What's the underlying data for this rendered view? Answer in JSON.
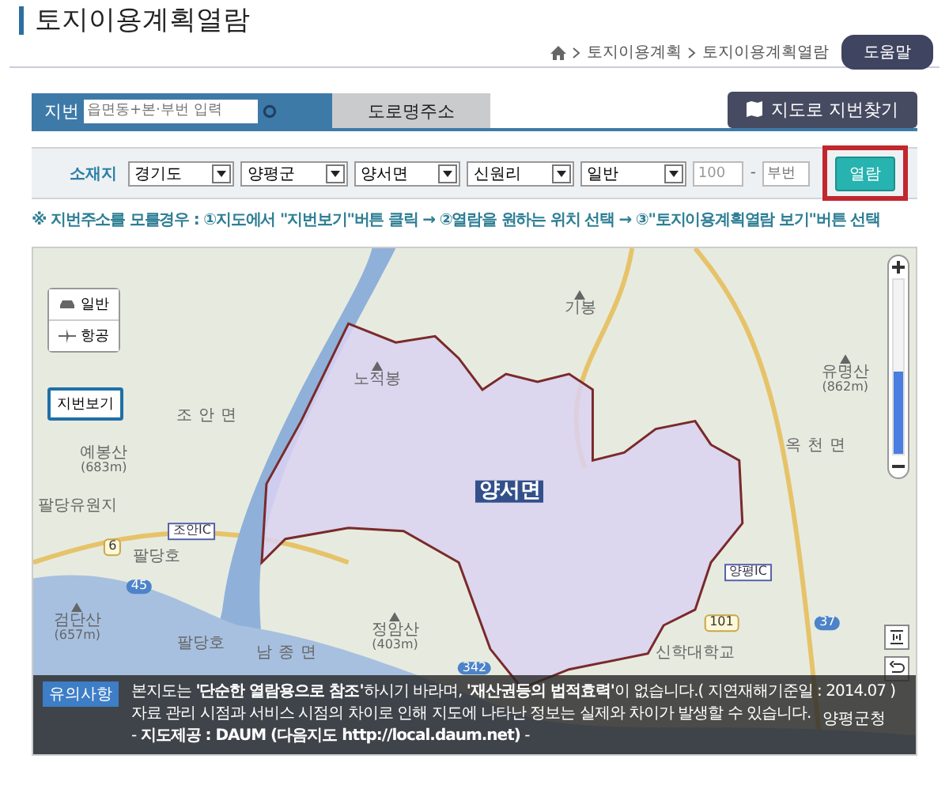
{
  "header": {
    "title": "토지이용계획열람",
    "breadcrumb": [
      "토지이용계획",
      "토지이용계획열람"
    ],
    "help_button": "도움말"
  },
  "search_tabs": [
    {
      "label": "지번",
      "selected": true,
      "placeholder": "읍면동+본·부번 입력"
    },
    {
      "label": "도로명주소",
      "selected": false
    }
  ],
  "map_search_button": "지도로 지번찾기",
  "location": {
    "label": "소재지",
    "selects": [
      "경기도",
      "양평군",
      "양서면",
      "신원리",
      "일반"
    ],
    "main_number": "100",
    "separator": "-",
    "sub_number_placeholder": "부번",
    "view_button": "열람",
    "view_button_highlighted": true
  },
  "hint": "※ 지번주소를 모를경우 : ①지도에서 \"지번보기\"버튼 클릭 → ②열람을 원하는 위치 선택 → ③\"토지이용계획열람 보기\"버튼 선택",
  "map": {
    "map_types": [
      {
        "kind": "road",
        "label": "일반"
      },
      {
        "kind": "aerial",
        "label": "항공"
      }
    ],
    "parcel_button": "지번보기",
    "zoom_level": {
      "level": 0.47
    },
    "labels": [
      {
        "kind": "peak",
        "text": "기봉"
      },
      {
        "kind": "peak",
        "text": "노적봉"
      },
      {
        "kind": "peak",
        "text": "유명산",
        "sub": "(862m)"
      },
      {
        "kind": "area",
        "text": "조안면"
      },
      {
        "kind": "place",
        "text": "예봉산",
        "sub": "(683m)"
      },
      {
        "kind": "area",
        "text": "옥천면"
      },
      {
        "kind": "main",
        "text": "양서면"
      },
      {
        "kind": "place",
        "text": "팔당유원지"
      },
      {
        "kind": "place",
        "text": "팔당호"
      },
      {
        "kind": "peak",
        "text": "검단산",
        "sub": "(657m)"
      },
      {
        "kind": "place",
        "text": "팔당호"
      },
      {
        "kind": "area",
        "text": "남종면"
      },
      {
        "kind": "peak",
        "text": "정암산",
        "sub": "(403m)"
      },
      {
        "kind": "ic",
        "text": "양평IC"
      },
      {
        "kind": "ic",
        "text": "조안IC"
      },
      {
        "kind": "route",
        "text": "6"
      },
      {
        "kind": "route",
        "text": "45"
      },
      {
        "kind": "route",
        "text": "342"
      },
      {
        "kind": "route",
        "text": "101"
      },
      {
        "kind": "route",
        "text": "37"
      },
      {
        "kind": "place",
        "text": "신학대학교"
      },
      {
        "kind": "place",
        "text": "양평군청"
      }
    ],
    "notice": {
      "badge": "유의사항",
      "lines": [
        "본지도는 **'단순한 열람용으로 참조'**하시기 바라며, **'재산권등의 법적효력'**이 없습니다.( 지연재해기준일 : 2014.07 )",
        "자료 관리 시점과 서비스 시점의 차이로 인해 지도에 나타난 정보는 실제와 차이가 발생할 수 있습니다.",
        "- **지도제공 : DAUM (다음지도 http://local.daum.net)** -"
      ]
    }
  }
}
